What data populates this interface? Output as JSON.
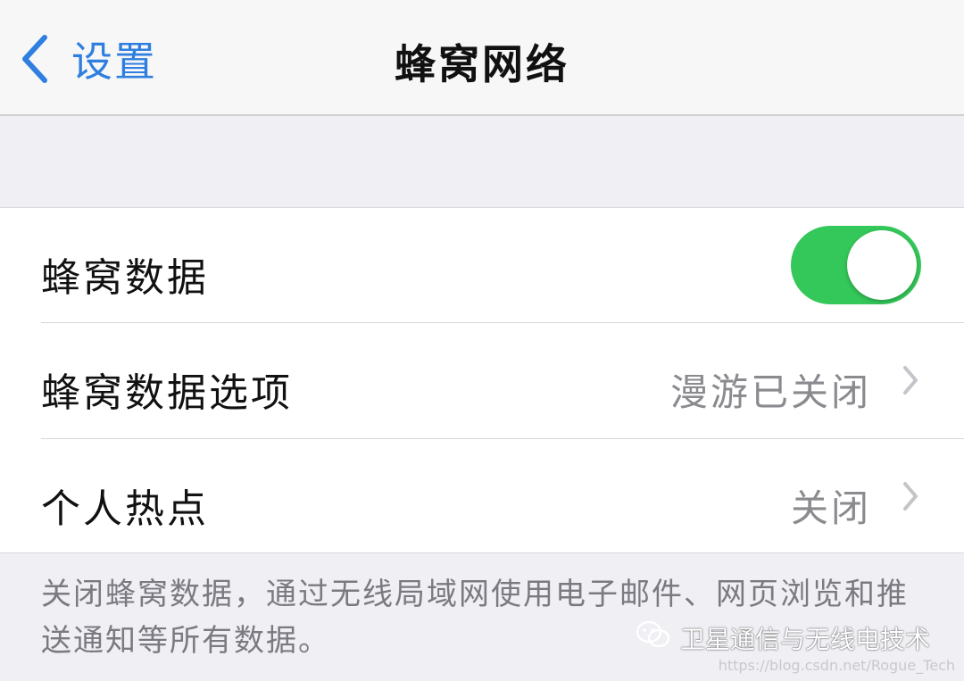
{
  "nav": {
    "back_label": "设置",
    "title": "蜂窝网络"
  },
  "rows": [
    {
      "label": "蜂窝数据",
      "toggle_on": true
    },
    {
      "label": "蜂窝数据选项",
      "value": "漫游已关闭"
    },
    {
      "label": "个人热点",
      "value": "关闭"
    }
  ],
  "footer_note": "关闭蜂窝数据，通过无线局域网使用电子邮件、网页浏览和推送通知等所有数据。",
  "watermark": {
    "text": "卫星通信与无线电技术",
    "url": "https://blog.csdn.net/Rogue_Tech"
  },
  "colors": {
    "accent": "#2f7fe0",
    "toggle_on": "#34c759",
    "secondary_text": "#8a8a8f"
  },
  "icons": {
    "back": "chevron-left-icon",
    "disclosure": "chevron-right-icon",
    "watermark": "wechat-icon"
  }
}
